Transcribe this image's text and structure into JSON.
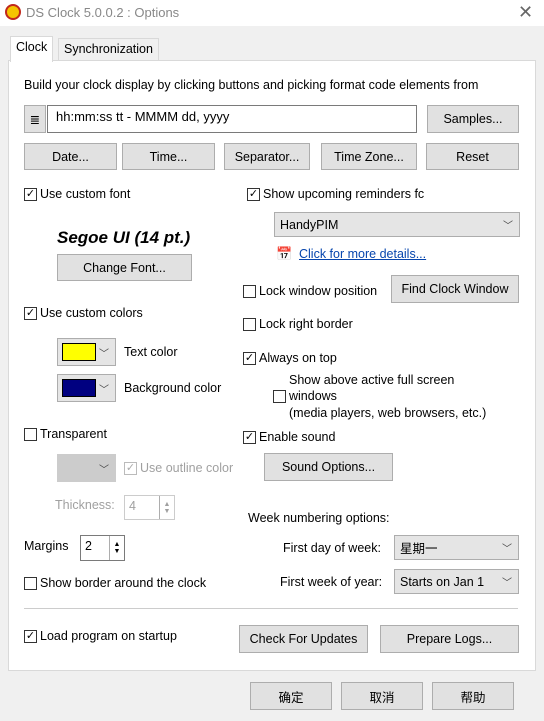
{
  "window": {
    "title": "DS Clock 5.0.0.2 : Options"
  },
  "tabs": [
    {
      "label": "Clock",
      "active": true
    },
    {
      "label": "Synchronization",
      "active": false
    }
  ],
  "clock": {
    "instruction": "Build your clock display by clicking buttons and picking format code elements from",
    "format_value": "hh:mm:ss tt - MMMM dd, yyyy",
    "samples": "Samples...",
    "date": "Date...",
    "time": "Time...",
    "separator": "Separator...",
    "timezone": "Time Zone...",
    "reset": "Reset",
    "use_custom_font": {
      "label": "Use custom font",
      "checked": true
    },
    "font_preview": "Segoe UI (14 pt.)",
    "change_font": "Change Font...",
    "use_custom_colors": {
      "label": "Use custom colors",
      "checked": true
    },
    "text_color": {
      "label": "Text color",
      "value": "#ffff00"
    },
    "background_color": {
      "label": "Background color",
      "value": "#000080"
    },
    "transparent": {
      "label": "Transparent",
      "checked": false
    },
    "use_outline_color": {
      "label": "Use outline color",
      "checked": true,
      "disabled": true
    },
    "thickness": {
      "label": "Thickness:",
      "value": "4"
    },
    "margins": {
      "label": "Margins",
      "value": "2"
    },
    "show_border": {
      "label": "Show border around the clock",
      "checked": false
    },
    "show_reminders": {
      "label": "Show upcoming reminders fc",
      "checked": true
    },
    "reminder_app": "HandyPIM",
    "more_details": "Click for more details...",
    "lock_position": {
      "label": "Lock window position",
      "checked": false
    },
    "find_clock": "Find Clock Window",
    "lock_right": {
      "label": "Lock right border",
      "checked": false
    },
    "always_on_top": {
      "label": "Always on top",
      "checked": true
    },
    "show_above_fullscreen": {
      "label1": "Show above active full screen",
      "label2": "windows",
      "label3": "(media players, web browsers, etc.)",
      "checked": false
    },
    "enable_sound": {
      "label": "Enable sound",
      "checked": true
    },
    "sound_options": "Sound Options...",
    "week_numbering": "Week numbering options:",
    "first_day": {
      "label": "First day of week:",
      "value": "星期一"
    },
    "first_week": {
      "label": "First week of year:",
      "value": "Starts on Jan 1"
    },
    "load_startup": {
      "label": "Load program on startup",
      "checked": true
    },
    "check_updates": "Check For Updates",
    "prepare_logs": "Prepare Logs..."
  },
  "footer": {
    "ok": "确定",
    "cancel": "取消",
    "help": "帮助"
  }
}
